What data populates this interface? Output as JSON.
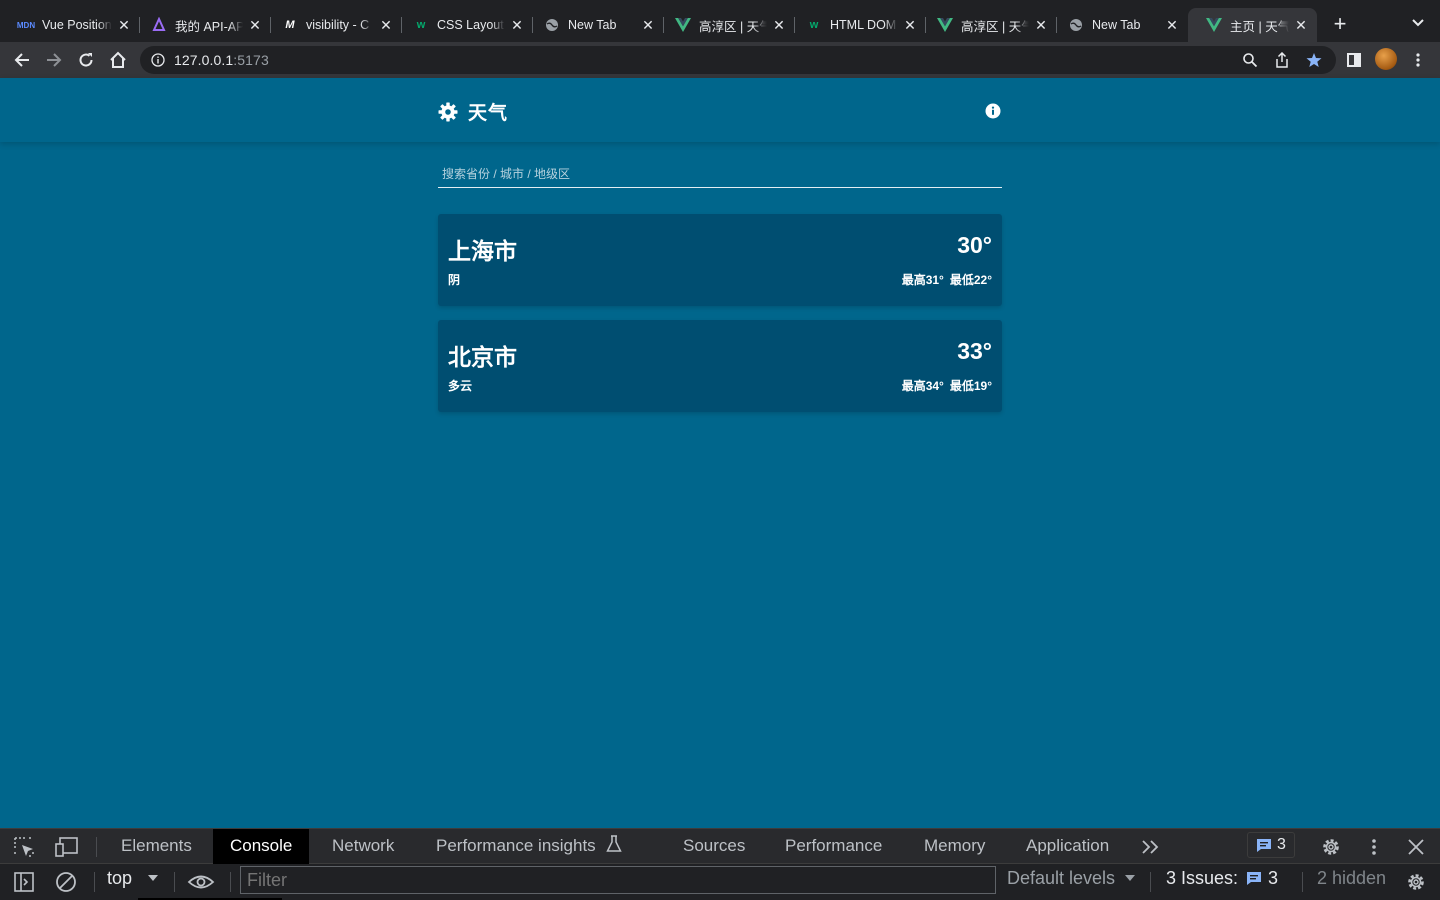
{
  "browser": {
    "tabs": [
      {
        "title": "Vue Position",
        "favicon": "mdn-icon",
        "active": false
      },
      {
        "title": "我的 API-API",
        "favicon": "apifox-icon",
        "active": false
      },
      {
        "title": "visibility - C",
        "favicon": "medium-icon",
        "active": false
      },
      {
        "title": "CSS Layout",
        "favicon": "w3schools-icon",
        "active": false
      },
      {
        "title": "New Tab",
        "favicon": "globe-icon",
        "active": false
      },
      {
        "title": "高淳区 | 天气",
        "favicon": "vue-icon",
        "active": false
      },
      {
        "title": "HTML DOM",
        "favicon": "w3schools-icon",
        "active": false
      },
      {
        "title": "高淳区 | 天气",
        "favicon": "vue-icon",
        "active": false
      },
      {
        "title": "New Tab",
        "favicon": "globe-icon",
        "active": false
      },
      {
        "title": "主页 | 天气",
        "favicon": "vue-icon",
        "active": true
      }
    ],
    "url_host": "127.0.0.1",
    "url_port": ":5173",
    "accent": "#8ab4f8"
  },
  "app": {
    "title": "天气",
    "search_placeholder": "搜索省份 / 城市 / 地级区",
    "background": "#00668c",
    "card_color": "#004e71",
    "cities": [
      {
        "name": "上海市",
        "condition": "阴",
        "temp": "30°",
        "high": "最高31°",
        "low": "最低22°"
      },
      {
        "name": "北京市",
        "condition": "多云",
        "temp": "33°",
        "high": "最高34°",
        "low": "最低19°"
      }
    ]
  },
  "devtools": {
    "tabs": [
      "Elements",
      "Console",
      "Network",
      "Performance insights",
      "Sources",
      "Performance",
      "Memory",
      "Application"
    ],
    "active_tab": "Console",
    "messages_count": "3",
    "context": "top",
    "filter_placeholder": "Filter",
    "levels": "Default levels",
    "issues_label": "3 Issues:",
    "issues_count": "3",
    "hidden": "2 hidden"
  }
}
